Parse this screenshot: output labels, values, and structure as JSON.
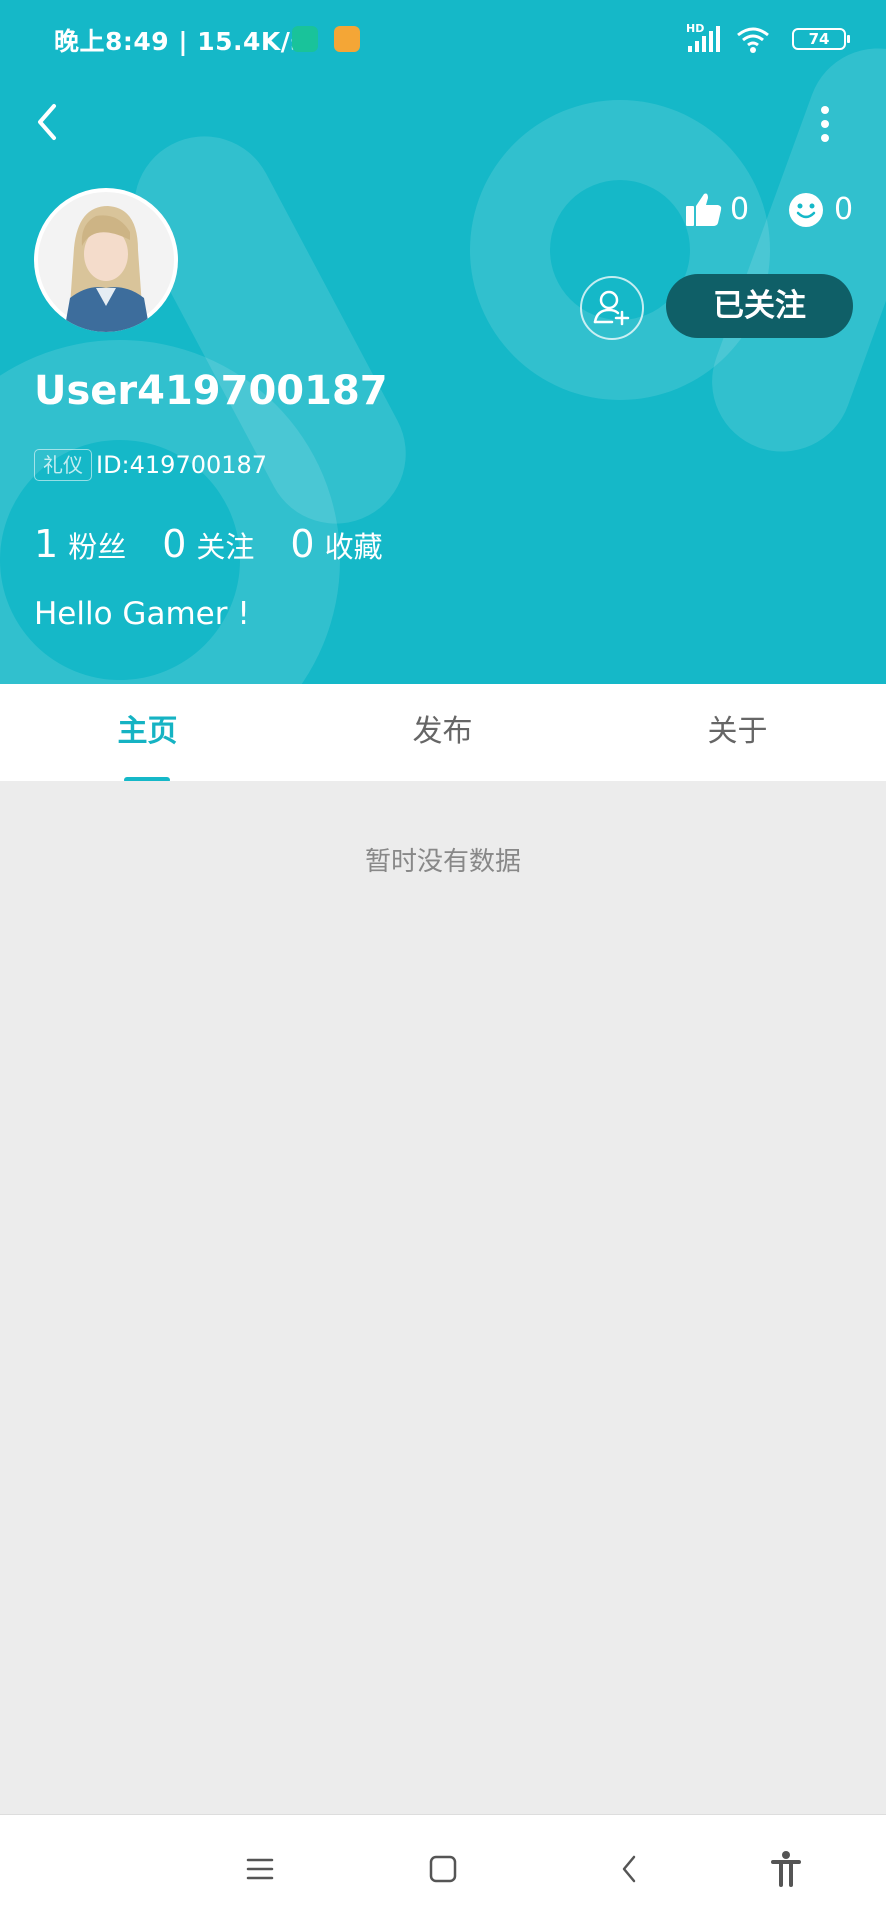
{
  "status_bar": {
    "time": "晚上8:49 | 15.4K/s",
    "network": "HD",
    "battery": "74"
  },
  "profile": {
    "username": "User419700187",
    "tag": "礼仪",
    "id_text": "ID:419700187",
    "bio": "Hello Gamer !",
    "stats": [
      {
        "count": "1",
        "label": "粉丝"
      },
      {
        "count": "0",
        "label": "关注"
      },
      {
        "count": "0",
        "label": "收藏"
      }
    ],
    "likes": "0",
    "smiles": "0",
    "follow_label": "已关注"
  },
  "tabs": [
    {
      "label": "主页",
      "active": true
    },
    {
      "label": "发布",
      "active": false
    },
    {
      "label": "关于",
      "active": false
    }
  ],
  "content": {
    "empty_text": "暂时没有数据"
  },
  "colors": {
    "header_bg": "#15b8c8",
    "accent": "#15b3c3",
    "follow_button_bg": "#0f5f67",
    "content_bg": "#ececec"
  },
  "icons": {
    "back": "back-arrow-icon",
    "more": "more-vertical-icon",
    "like": "thumbs-up-icon",
    "smile": "smiley-icon",
    "add_friend": "add-user-icon",
    "nav_menu": "menu-icon",
    "nav_home": "home-square-icon",
    "nav_back": "back-chevron-icon",
    "nav_accessibility": "accessibility-icon"
  }
}
